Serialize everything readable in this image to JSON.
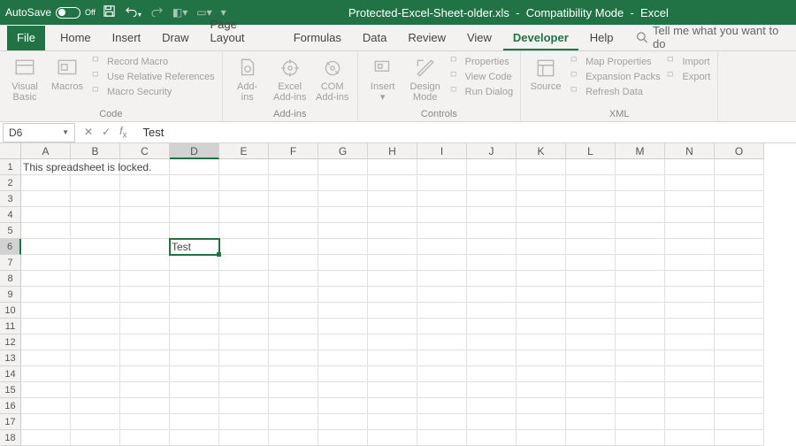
{
  "title": {
    "autosave_label": "AutoSave",
    "autosave_state": "Off",
    "document": "Protected-Excel-Sheet-older.xls",
    "mode": "Compatibility Mode",
    "app": "Excel"
  },
  "tabs": {
    "file": "File",
    "items": [
      "Home",
      "Insert",
      "Draw",
      "Page Layout",
      "Formulas",
      "Data",
      "Review",
      "View",
      "Developer",
      "Help"
    ],
    "active_index": 8,
    "tell_me": "Tell me what you want to do"
  },
  "ribbon": {
    "groups": [
      {
        "label": "Code",
        "big": [
          {
            "name": "visual-basic",
            "label": "Visual\nBasic"
          },
          {
            "name": "macros",
            "label": "Macros"
          }
        ],
        "small": [
          "Record Macro",
          "Use Relative References",
          "Macro Security"
        ]
      },
      {
        "label": "Add-ins",
        "big": [
          {
            "name": "addins",
            "label": "Add-\nins"
          },
          {
            "name": "excel-addins",
            "label": "Excel\nAdd-ins"
          },
          {
            "name": "com-addins",
            "label": "COM\nAdd-ins"
          }
        ],
        "small": []
      },
      {
        "label": "Controls",
        "big": [
          {
            "name": "insert-control",
            "label": "Insert\n▾"
          },
          {
            "name": "design-mode",
            "label": "Design\nMode"
          }
        ],
        "small": [
          "Properties",
          "View Code",
          "Run Dialog"
        ]
      },
      {
        "label": "XML",
        "big": [
          {
            "name": "source",
            "label": "Source"
          }
        ],
        "small": [
          "Map Properties",
          "Expansion Packs",
          "Refresh Data"
        ],
        "small2": [
          "Import",
          "Export"
        ]
      }
    ]
  },
  "formula_bar": {
    "namebox": "D6",
    "value": "Test"
  },
  "grid": {
    "columns": [
      "A",
      "B",
      "C",
      "D",
      "E",
      "F",
      "G",
      "H",
      "I",
      "J",
      "K",
      "L",
      "M",
      "N",
      "O"
    ],
    "rows": 18,
    "selected": {
      "row": 6,
      "col": "D"
    },
    "cells": {
      "A1": "This spreadsheet is locked.",
      "D6": "Test"
    }
  }
}
